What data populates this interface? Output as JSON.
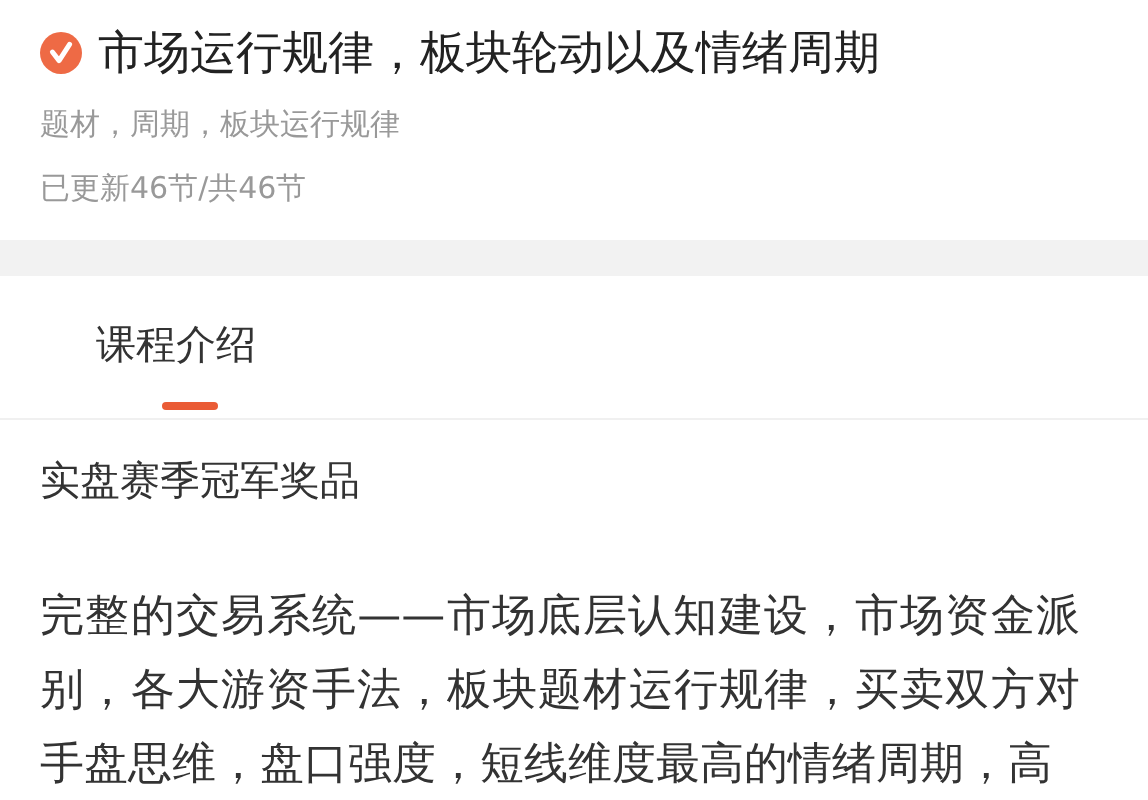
{
  "course": {
    "title": "市场运行规律，板块轮动以及情绪周期",
    "verified": true,
    "tags": "题材，周期，板块运行规律",
    "progress": "已更新46节/共46节"
  },
  "tabs": [
    {
      "label": "课程介绍",
      "selected": true
    }
  ],
  "intro": {
    "heading": "实盘赛季冠军奖品",
    "paragraph": "完整的交易系统——市场底层认知建设，市场资金派别，各大游资手法，板块题材运行规律，买卖双方对手盘思维，盘口强度，短线维度最高的情绪周期，高"
  }
}
